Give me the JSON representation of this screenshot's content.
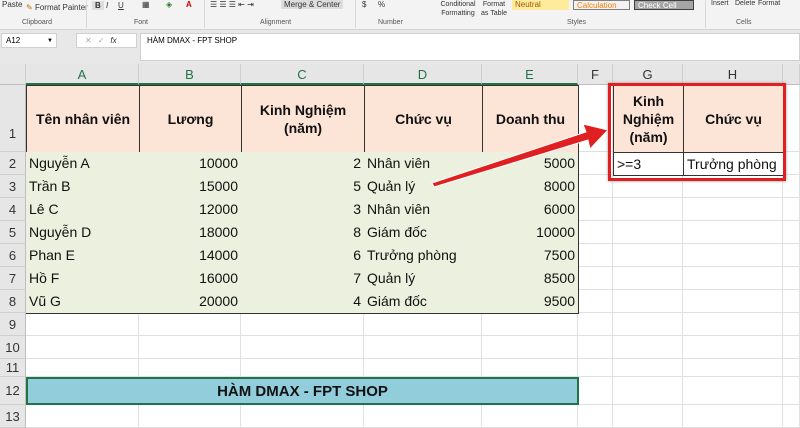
{
  "ribbon": {
    "paste": "Paste",
    "format_painter": "Format Painter",
    "clipboard": "Clipboard",
    "bold": "B",
    "italic": "I",
    "underline": "U",
    "font": "Font",
    "alignment": "Alignment",
    "merge_center": "Merge & Center",
    "currency": "$",
    "percent": "%",
    "number": "Number",
    "conditional_formatting": "Conditional Formatting",
    "format_as_table": "Format as Table",
    "style_neutral": "Neutral",
    "style_calculation": "Calculation",
    "style_check_cell": "Check Cell",
    "styles": "Styles",
    "insert": "Insert",
    "delete": "Delete",
    "format": "Format",
    "cells": "Cells"
  },
  "formula_bar": {
    "name_box": "A12",
    "cancel": "✕",
    "enter": "✓",
    "fx": "fx",
    "content": "HÀM DMAX - FPT SHOP"
  },
  "columns": [
    "A",
    "B",
    "C",
    "D",
    "E",
    "F",
    "G",
    "H"
  ],
  "rows": [
    "1",
    "2",
    "3",
    "4",
    "5",
    "6",
    "7",
    "8",
    "9",
    "10",
    "11",
    "12",
    "13"
  ],
  "table": {
    "headers": [
      "Tên nhân viên",
      "Lương",
      "Kinh Nghiệm (năm)",
      "Chức vụ",
      "Doanh thu"
    ],
    "rows": [
      [
        "Nguyễn A",
        "10000",
        "2",
        "Nhân viên",
        "5000"
      ],
      [
        "Trần B",
        "15000",
        "5",
        "Quản lý",
        "8000"
      ],
      [
        "Lê C",
        "12000",
        "3",
        "Nhân viên",
        "6000"
      ],
      [
        "Nguyễn D",
        "18000",
        "8",
        "Giám đốc",
        "10000"
      ],
      [
        "Phan E",
        "14000",
        "6",
        "Trưởng phòng",
        "7500"
      ],
      [
        "Hồ F",
        "16000",
        "7",
        "Quản lý",
        "8500"
      ],
      [
        "Vũ G",
        "20000",
        "4",
        "Giám đốc",
        "9500"
      ]
    ]
  },
  "criteria": {
    "headers": [
      "Kinh Nghiệm (năm)",
      "Chức vụ"
    ],
    "values": [
      ">=3",
      "Trưởng phòng"
    ]
  },
  "banner": "HÀM DMAX - FPT SHOP",
  "colors": {
    "header_fill": "#fce4d6",
    "data_fill": "#ebf1de",
    "banner_fill": "#92cddc",
    "highlight": "#e02020"
  }
}
